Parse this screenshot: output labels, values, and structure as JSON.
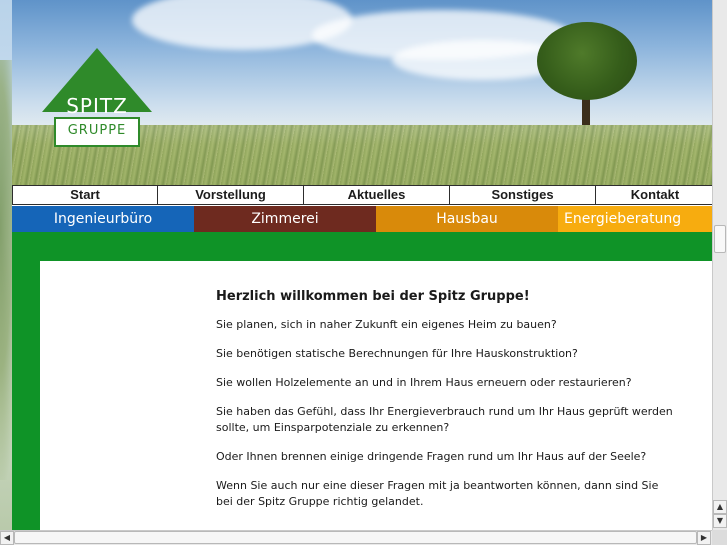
{
  "logo": {
    "name": "SPITZ",
    "sub": "GRUPPE",
    "color": "#2f8a2a"
  },
  "nav": [
    {
      "label": "Start"
    },
    {
      "label": "Vorstellung"
    },
    {
      "label": "Aktuelles"
    },
    {
      "label": "Sonstiges"
    },
    {
      "label": "Kontakt"
    }
  ],
  "categories": [
    {
      "label": "Ingenieurbüro",
      "color": "#1565b8"
    },
    {
      "label": "Zimmerei",
      "color": "#6e2a1f"
    },
    {
      "label": "Hausbau",
      "color": "#d98a0a"
    },
    {
      "label": "Energieberatung",
      "color": "#f7ac0f"
    }
  ],
  "content": {
    "heading": "Herzlich willkommen bei der Spitz Gruppe!",
    "paragraphs": [
      "Sie planen, sich in naher Zukunft ein eigenes Heim zu bauen?",
      "Sie benötigen statische Berechnungen für Ihre Hauskonstruktion?",
      "Sie wollen Holzelemente an und in Ihrem Haus erneuern oder restaurieren?",
      "Sie haben das Gefühl, dass Ihr Energieverbrauch rund um Ihr Haus geprüft werden sollte, um Einsparpotenziale zu erkennen?",
      "Oder Ihnen brennen einige dringende Fragen rund um Ihr Haus auf der Seele?",
      "Wenn Sie auch nur eine dieser Fragen mit ja beantworten können, dann sind Sie bei der Spitz Gruppe richtig gelandet."
    ]
  },
  "colors": {
    "green_band": "#0f9327"
  }
}
